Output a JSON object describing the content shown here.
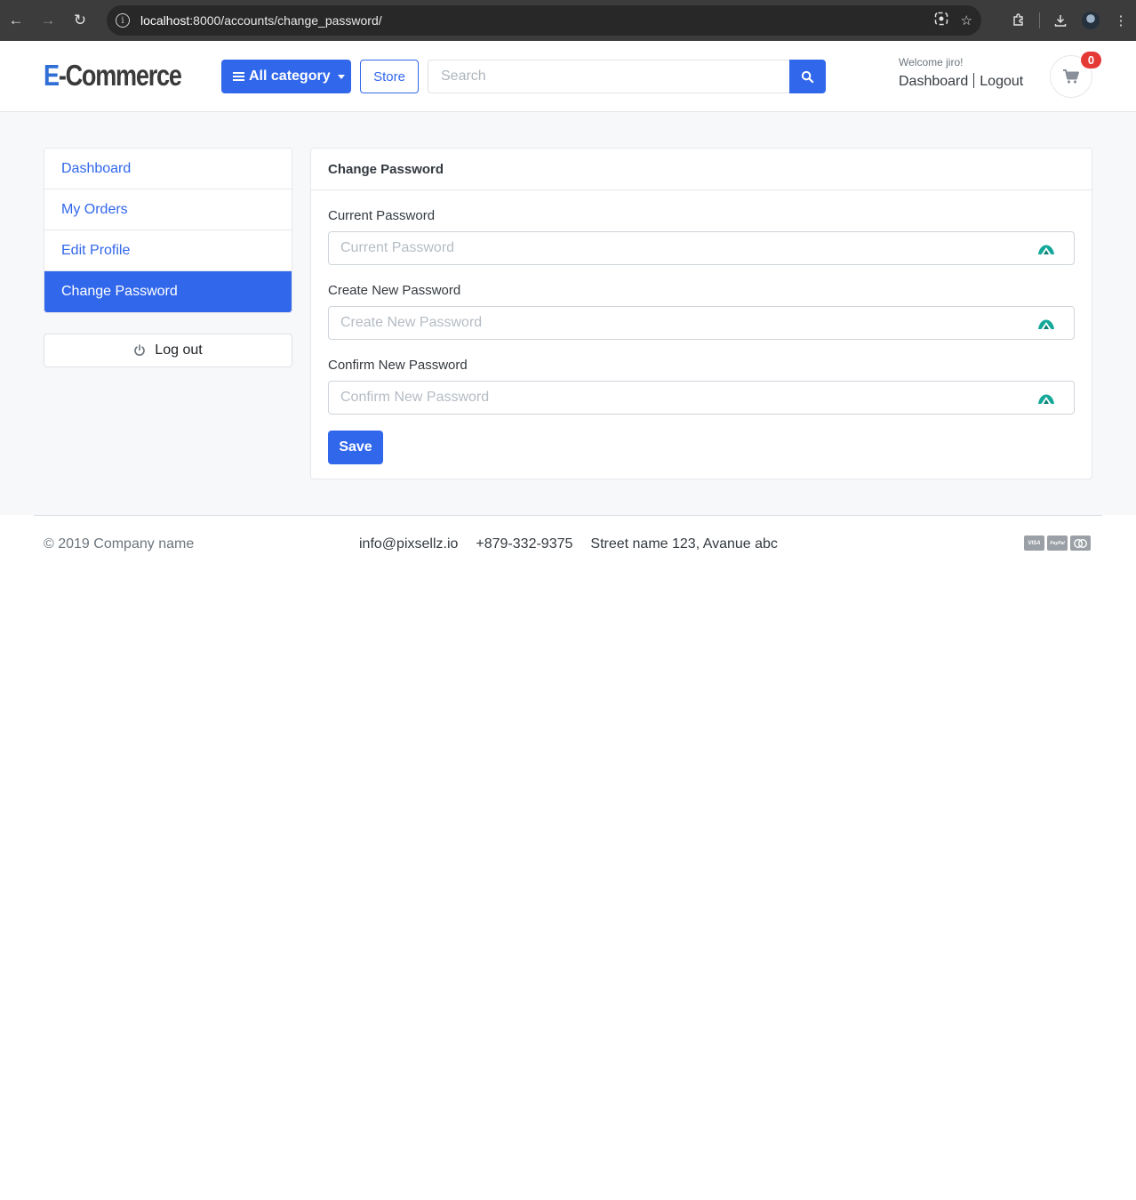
{
  "browser": {
    "url_host": "localhost",
    "url_path": ":8000/accounts/change_password/"
  },
  "header": {
    "brand_prefix": "E",
    "brand_rest": "-Commerce",
    "category_button": "All category",
    "store_button": "Store",
    "search_placeholder": "Search",
    "welcome": "Welcome jiro!",
    "dashboard_link": "Dashboard",
    "logout_link": "Logout",
    "cart_count": "0"
  },
  "sidebar": {
    "items": [
      {
        "label": "Dashboard"
      },
      {
        "label": "My Orders"
      },
      {
        "label": "Edit Profile"
      },
      {
        "label": "Change Password"
      }
    ],
    "active_index": 3,
    "logout_button": "Log out"
  },
  "form": {
    "title": "Change Password",
    "fields": [
      {
        "label": "Current Password",
        "placeholder": "Current Password"
      },
      {
        "label": "Create New Password",
        "placeholder": "Create New Password"
      },
      {
        "label": "Confirm New Password",
        "placeholder": "Confirm New Password"
      }
    ],
    "save_button": "Save"
  },
  "footer": {
    "copyright": "© 2019 Company name",
    "email": "info@pixsellz.io",
    "phone": "+879-332-9375",
    "address": "Street name 123, Avanue abc",
    "payment_methods": [
      "VISA",
      "PayPal",
      "MasterCard"
    ]
  },
  "colors": {
    "primary": "#3167eb",
    "badge": "#e53935",
    "password_manager_icon": "#14a89a"
  }
}
